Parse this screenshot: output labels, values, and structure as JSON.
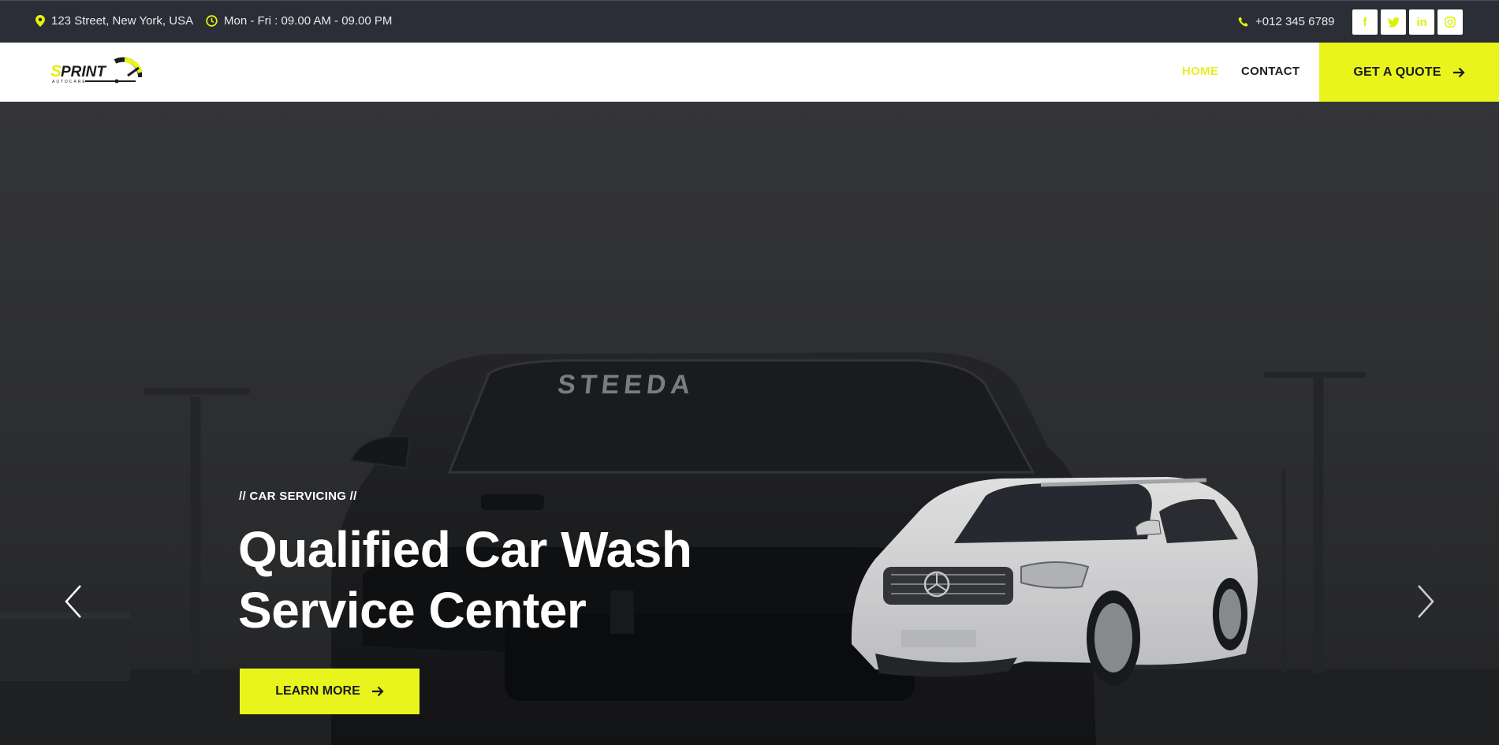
{
  "topbar": {
    "address": "123 Street, New York, USA",
    "hours": "Mon - Fri : 09.00 AM - 09.00 PM",
    "phone": "+012 345 6789",
    "socials": [
      {
        "icon": "facebook-icon",
        "glyph": "f"
      },
      {
        "icon": "twitter-icon",
        "glyph": "t"
      },
      {
        "icon": "linkedin-icon",
        "glyph": "in"
      },
      {
        "icon": "instagram-icon",
        "glyph": "◎"
      }
    ]
  },
  "nav": {
    "logo_text": "SPRINT",
    "logo_sub": "AUTOCARE",
    "home": "HOME",
    "contact": "CONTACT",
    "quote": "GET A QUOTE"
  },
  "hero": {
    "kicker": "// CAR SERVICING //",
    "title_line1": "Qualified Car Wash",
    "title_line2": "Service Center",
    "cta": "LEARN MORE",
    "windshield_text": "STEEDA"
  },
  "colors": {
    "accent": "#e9f41c",
    "topbar_bg": "#2b2e36",
    "nav_bg": "#ffffff"
  }
}
